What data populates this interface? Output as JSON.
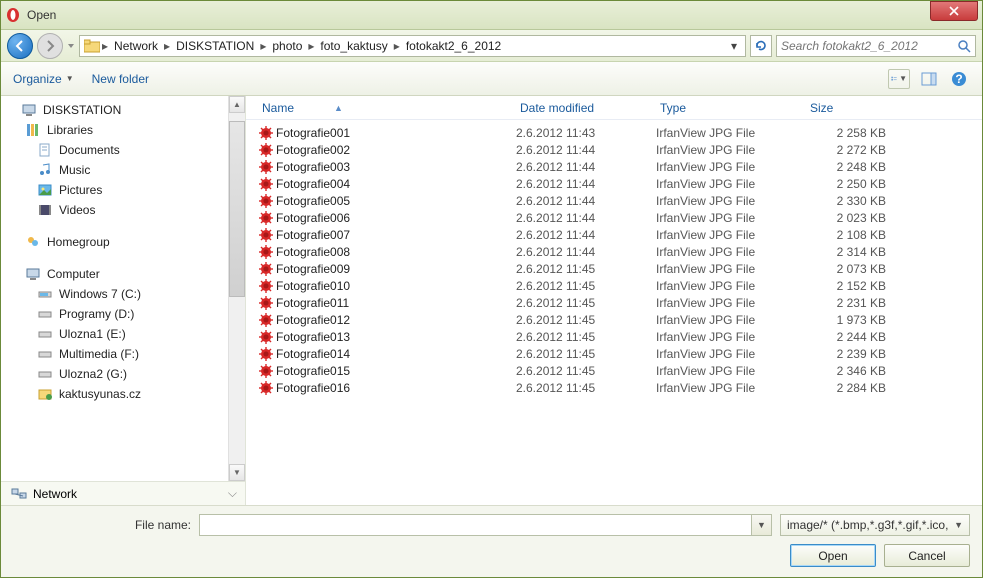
{
  "window": {
    "title": "Open"
  },
  "breadcrumb": {
    "segments": [
      "Network",
      "DISKSTATION",
      "photo",
      "foto_kaktusy",
      "fotokakt2_6_2012"
    ]
  },
  "search": {
    "placeholder": "Search fotokakt2_6_2012"
  },
  "toolbar": {
    "organize": "Organize",
    "newfolder": "New folder"
  },
  "sidebar": {
    "diskstation": "DISKSTATION",
    "libraries": "Libraries",
    "lib_items": [
      "Documents",
      "Music",
      "Pictures",
      "Videos"
    ],
    "homegroup": "Homegroup",
    "computer": "Computer",
    "comp_items": [
      "Windows 7 (C:)",
      "Programy (D:)",
      "Ulozna1 (E:)",
      "Multimedia (F:)",
      "Ulozna2 (G:)",
      "kaktusyunas.cz"
    ],
    "network": "Network"
  },
  "columns": {
    "name": "Name",
    "date": "Date modified",
    "type": "Type",
    "size": "Size"
  },
  "files": [
    {
      "name": "Fotografie001",
      "date": "2.6.2012 11:43",
      "type": "IrfanView JPG File",
      "size": "2 258 KB"
    },
    {
      "name": "Fotografie002",
      "date": "2.6.2012 11:44",
      "type": "IrfanView JPG File",
      "size": "2 272 KB"
    },
    {
      "name": "Fotografie003",
      "date": "2.6.2012 11:44",
      "type": "IrfanView JPG File",
      "size": "2 248 KB"
    },
    {
      "name": "Fotografie004",
      "date": "2.6.2012 11:44",
      "type": "IrfanView JPG File",
      "size": "2 250 KB"
    },
    {
      "name": "Fotografie005",
      "date": "2.6.2012 11:44",
      "type": "IrfanView JPG File",
      "size": "2 330 KB"
    },
    {
      "name": "Fotografie006",
      "date": "2.6.2012 11:44",
      "type": "IrfanView JPG File",
      "size": "2 023 KB"
    },
    {
      "name": "Fotografie007",
      "date": "2.6.2012 11:44",
      "type": "IrfanView JPG File",
      "size": "2 108 KB"
    },
    {
      "name": "Fotografie008",
      "date": "2.6.2012 11:44",
      "type": "IrfanView JPG File",
      "size": "2 314 KB"
    },
    {
      "name": "Fotografie009",
      "date": "2.6.2012 11:45",
      "type": "IrfanView JPG File",
      "size": "2 073 KB"
    },
    {
      "name": "Fotografie010",
      "date": "2.6.2012 11:45",
      "type": "IrfanView JPG File",
      "size": "2 152 KB"
    },
    {
      "name": "Fotografie011",
      "date": "2.6.2012 11:45",
      "type": "IrfanView JPG File",
      "size": "2 231 KB"
    },
    {
      "name": "Fotografie012",
      "date": "2.6.2012 11:45",
      "type": "IrfanView JPG File",
      "size": "1 973 KB"
    },
    {
      "name": "Fotografie013",
      "date": "2.6.2012 11:45",
      "type": "IrfanView JPG File",
      "size": "2 244 KB"
    },
    {
      "name": "Fotografie014",
      "date": "2.6.2012 11:45",
      "type": "IrfanView JPG File",
      "size": "2 239 KB"
    },
    {
      "name": "Fotografie015",
      "date": "2.6.2012 11:45",
      "type": "IrfanView JPG File",
      "size": "2 346 KB"
    },
    {
      "name": "Fotografie016",
      "date": "2.6.2012 11:45",
      "type": "IrfanView JPG File",
      "size": "2 284 KB"
    }
  ],
  "bottom": {
    "filename_label": "File name:",
    "filter": "image/* (*.bmp,*.g3f,*.gif,*.ico,",
    "open": "Open",
    "cancel": "Cancel"
  }
}
